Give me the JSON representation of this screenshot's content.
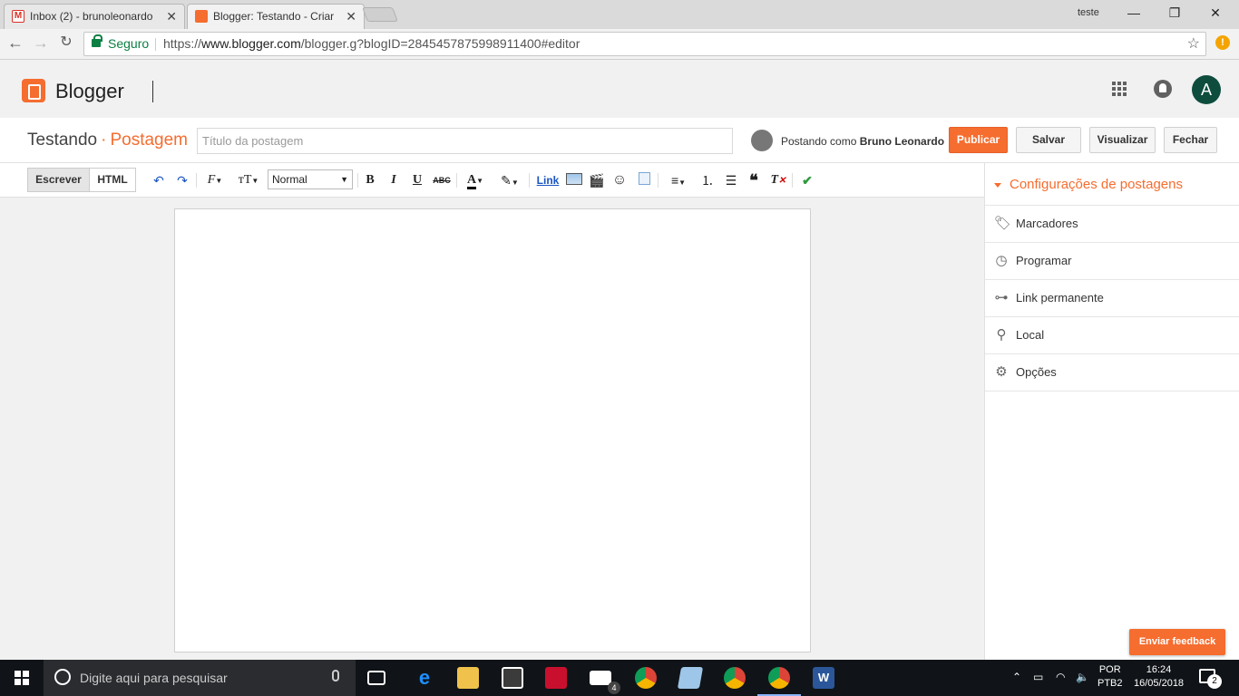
{
  "browser": {
    "tabs": [
      {
        "title": "Inbox (2) - brunoleonardo",
        "color": "#d93025"
      },
      {
        "title": "Blogger: Testando - Criar",
        "color": "#f56d2f"
      }
    ],
    "user": "teste",
    "window_controls": {
      "minimize": "—",
      "restore": "❐",
      "close": "✕"
    },
    "secure_label": "Seguro",
    "url_scheme": "https://",
    "url_domain": "www.blogger.com",
    "url_path": "/blogger.g?blogID=2845457875998911400#editor"
  },
  "blogger": {
    "app_name": "Blogger",
    "avatar_letter": "A",
    "blog_name": "Testando",
    "separator": "·",
    "section": "Postagem",
    "title_placeholder": "Título da postagem",
    "posting_as_prefix": "Postando como",
    "posting_as_user": "Bruno Leonardo",
    "buttons": {
      "publish": "Publicar",
      "save": "Salvar",
      "preview": "Visualizar",
      "close": "Fechar"
    }
  },
  "editor": {
    "mode_compose": "Escrever",
    "mode_html": "HTML",
    "format_value": "Normal",
    "link_label": "Link",
    "toolbar_icons": [
      "undo-icon",
      "redo-icon",
      "font-family-icon",
      "font-size-icon",
      "bold-icon",
      "italic-icon",
      "underline-icon",
      "strikethrough-icon",
      "text-color-icon",
      "highlight-icon",
      "image-icon",
      "video-icon",
      "emoji-icon",
      "jump-break-icon",
      "align-icon",
      "numbered-list-icon",
      "bulleted-list-icon",
      "quote-icon",
      "clear-format-icon",
      "spellcheck-icon"
    ],
    "body": ""
  },
  "sidebar": {
    "heading": "Configurações de postagens",
    "items": [
      {
        "label": "Marcadores",
        "icon": "tag-icon"
      },
      {
        "label": "Programar",
        "icon": "clock-icon"
      },
      {
        "label": "Link permanente",
        "icon": "link-icon"
      },
      {
        "label": "Local",
        "icon": "location-pin-icon"
      },
      {
        "label": "Opções",
        "icon": "gear-icon"
      }
    ]
  },
  "feedback_label": "Enviar feedback",
  "taskbar": {
    "search_placeholder": "Digite aqui para pesquisar",
    "mail_badge": "4",
    "lang_top": "POR",
    "lang_bottom": "PTB2",
    "time": "16:24",
    "date": "16/05/2018",
    "notification_count": "2"
  },
  "colors": {
    "accent": "#f56d2f",
    "secure_green": "#0b8043",
    "avatar_bg": "#0e4d3e"
  }
}
